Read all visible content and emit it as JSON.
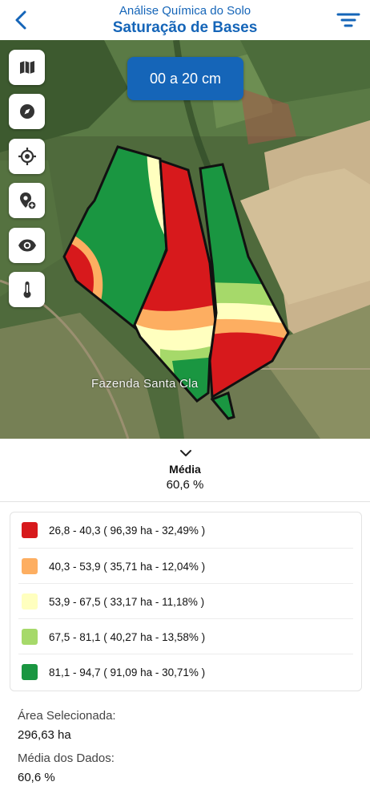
{
  "header": {
    "subtitle": "Análise Química do Solo",
    "title": "Saturação de Bases",
    "back_icon": "chevron-left-icon",
    "filter_icon": "filter-icon"
  },
  "map": {
    "depth_label": "00 a 20 cm",
    "farm_label": "Fazenda Santa Cla",
    "tools": [
      "map-layers-icon",
      "compass-icon",
      "locate-icon",
      "add-marker-icon",
      "eye-icon",
      "thermometer-icon"
    ]
  },
  "summary": {
    "average_label": "Média",
    "average_value": "60,6 %"
  },
  "legend": [
    {
      "text": "26,8 - 40,3 ( 96,39 ha - 32,49% )",
      "color": "#d7191c"
    },
    {
      "text": "40,3 - 53,9 ( 35,71 ha - 12,04% )",
      "color": "#fdae61"
    },
    {
      "text": "53,9 - 67,5 ( 33,17 ha - 11,18% )",
      "color": "#ffffbf"
    },
    {
      "text": "67,5 - 81,1 ( 40,27 ha - 13,58% )",
      "color": "#a6d96a"
    },
    {
      "text": "81,1 - 94,7 ( 91,09 ha - 30,71% )",
      "color": "#1a9641"
    }
  ],
  "info": {
    "area_label": "Área Selecionada:",
    "area_value": "296,63 ha",
    "data_avg_label": "Média dos Dados:",
    "data_avg_value": "60,6 %"
  },
  "colors": {
    "brand": "#1565b8"
  }
}
